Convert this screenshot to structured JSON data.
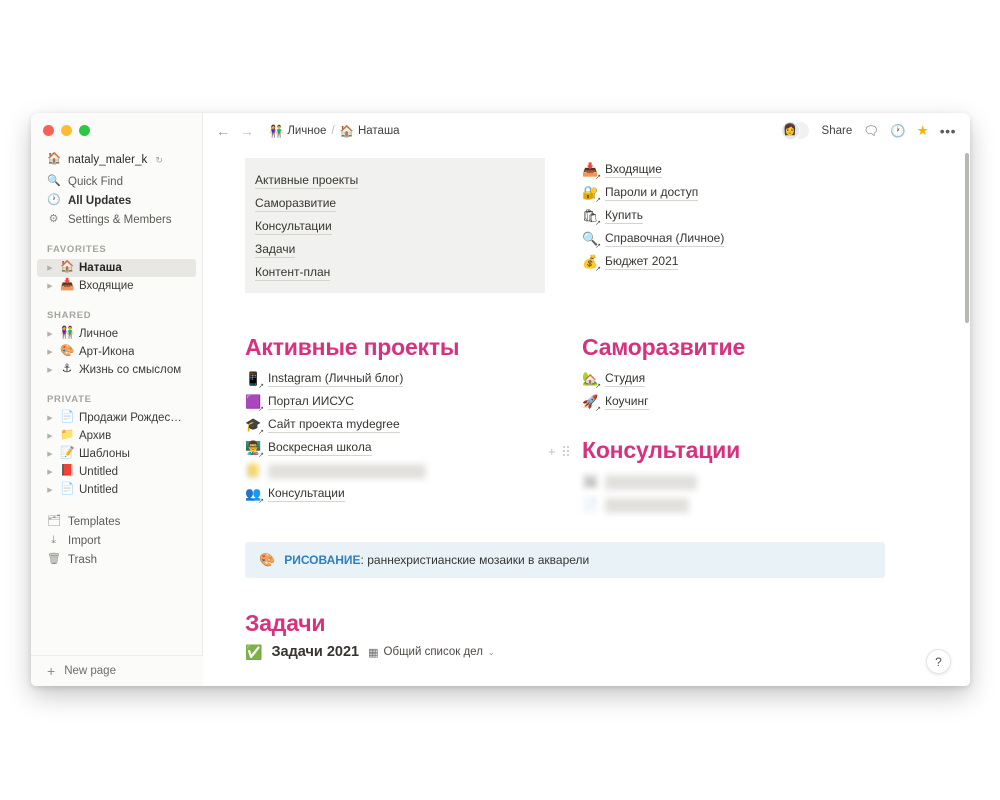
{
  "window": {
    "traffic_lights": [
      "close",
      "minimize",
      "maximize"
    ]
  },
  "sidebar": {
    "workspace": {
      "emoji": "🏠",
      "name": "nataly_maler_k",
      "sync_icon": "↻"
    },
    "nav": [
      {
        "icon": "🔍",
        "label": "Quick Find",
        "icon_name": "search-icon",
        "strong": false
      },
      {
        "icon": "🕐",
        "label": "All Updates",
        "icon_name": "clock-icon",
        "strong": true
      },
      {
        "icon": "⚙",
        "label": "Settings & Members",
        "icon_name": "gear-icon",
        "strong": false
      }
    ],
    "sections": [
      {
        "label": "FAVORITES",
        "items": [
          {
            "emoji": "🏠",
            "title": "Наташа",
            "selected": true
          },
          {
            "emoji": "📥",
            "title": "Входящие",
            "selected": false
          }
        ]
      },
      {
        "label": "SHARED",
        "items": [
          {
            "emoji": "👫",
            "title": "Личное",
            "selected": false
          },
          {
            "emoji": "🎨",
            "title": "Арт-Икона",
            "selected": false
          },
          {
            "emoji": "⚓",
            "title": "Жизнь со смыслом",
            "selected": false
          }
        ]
      },
      {
        "label": "PRIVATE",
        "items": [
          {
            "emoji": "📄",
            "title": "Продажи Рождествен…",
            "selected": false
          },
          {
            "emoji": "📁",
            "title": "Архив",
            "selected": false
          },
          {
            "emoji": "📝",
            "title": "Шаблоны",
            "selected": false
          },
          {
            "emoji": "📕",
            "title": "Untitled",
            "selected": false
          },
          {
            "emoji": "📄",
            "title": "Untitled",
            "selected": false
          }
        ]
      }
    ],
    "bottom_nav": [
      {
        "icon": "🗂",
        "label": "Templates",
        "icon_name": "templates-icon"
      },
      {
        "icon": "⤓",
        "label": "Import",
        "icon_name": "import-icon"
      },
      {
        "icon": "🗑",
        "label": "Trash",
        "icon_name": "trash-icon"
      }
    ],
    "new_page": {
      "plus": "+",
      "label": "New page"
    }
  },
  "topbar": {
    "back_arrow": "←",
    "forward_arrow": "→",
    "breadcrumbs": [
      {
        "emoji": "👫",
        "label": "Личное"
      },
      {
        "emoji": "🏠",
        "label": "Наташа"
      }
    ],
    "separator": "/",
    "avatars": [
      "👩",
      ""
    ],
    "share_label": "Share",
    "comment_icon": "🗨",
    "history_icon": "🕐",
    "star_icon": "★",
    "more_icon": "•••"
  },
  "content": {
    "toc": {
      "items": [
        "Активные проекты",
        "Саморазвитие",
        "Консультации",
        "Задачи",
        "Контент-план"
      ]
    },
    "quick_links": [
      {
        "emoji": "📥",
        "label": "Входящие"
      },
      {
        "emoji": "🔐",
        "label": "Пароли и доступ"
      },
      {
        "emoji": "🛍",
        "label": "Купить"
      },
      {
        "emoji": "🔍",
        "label": "Справочная (Личное)"
      },
      {
        "emoji": "💰",
        "label": "Бюджет 2021"
      }
    ],
    "active_projects": {
      "heading": "Активные проекты",
      "links": [
        {
          "emoji": "📱",
          "label": "Instagram (Личный блог)",
          "redacted": false
        },
        {
          "emoji": "🟪",
          "label": "Портал ИИСУС",
          "redacted": false
        },
        {
          "emoji": "🎓",
          "label": "Сайт проекта mydegree",
          "redacted": false
        },
        {
          "emoji": "👨‍🏫",
          "label": "Воскресная школа",
          "redacted": false
        },
        {
          "emoji": "📒",
          "label": "Школа приемных родителей",
          "redacted": true
        },
        {
          "emoji": "👥",
          "label": "Консультации",
          "redacted": false
        }
      ]
    },
    "self_development": {
      "heading": "Саморазвитие",
      "links": [
        {
          "emoji": "🏡",
          "label": "Студия",
          "redacted": false
        },
        {
          "emoji": "🚀",
          "label": "Коучинг",
          "redacted": false
        }
      ]
    },
    "consultations": {
      "heading": "Консультации",
      "add_icon": "+",
      "links": [
        {
          "emoji": "🖼",
          "label": "Имена Бурусова",
          "redacted": true
        },
        {
          "emoji": "📄",
          "label": "Светлана Тарн",
          "redacted": true
        }
      ]
    },
    "callout": {
      "emoji": "🎨",
      "strong": "РИСОВАНИЕ",
      "rest": ": раннехристианские мозаики в акварели"
    },
    "tasks": {
      "heading": "Задачи",
      "database": {
        "emoji": "✅",
        "title": "Задачи 2021"
      },
      "view": {
        "icon": "▦",
        "label": "Общий список дел",
        "chevron": "⌄"
      }
    },
    "help_button": "?"
  },
  "colors": {
    "heading_pink": "#d6327f",
    "callout_bg": "#e8f2f7",
    "callout_accent": "#2c7fc4",
    "toc_bg": "#f1f1ef",
    "sidebar_bg": "#fbfbfa",
    "selected_row": "#e8e7e4",
    "star_gold": "#f7b500"
  }
}
